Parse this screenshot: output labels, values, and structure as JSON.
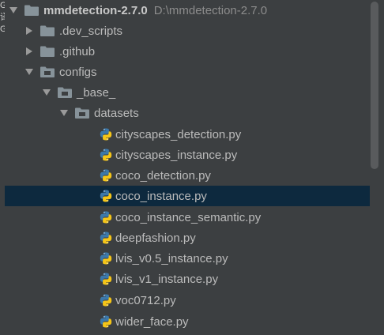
{
  "left_strip": [
    "G",
    "译",
    "G"
  ],
  "tree": {
    "root": {
      "label": "mmdetection-2.7.0",
      "path": "D:\\mmdetection-2.7.0"
    },
    "items": [
      {
        "label": ".dev_scripts"
      },
      {
        "label": ".github"
      },
      {
        "label": "configs"
      },
      {
        "label": "_base_"
      },
      {
        "label": "datasets"
      },
      {
        "label": "cityscapes_detection.py"
      },
      {
        "label": "cityscapes_instance.py"
      },
      {
        "label": "coco_detection.py"
      },
      {
        "label": "coco_instance.py"
      },
      {
        "label": "coco_instance_semantic.py"
      },
      {
        "label": "deepfashion.py"
      },
      {
        "label": "lvis_v0.5_instance.py"
      },
      {
        "label": "lvis_v1_instance.py"
      },
      {
        "label": "voc0712.py"
      },
      {
        "label": "wider_face.py"
      }
    ]
  },
  "colors": {
    "background": "#3c3f41",
    "selection": "#0d293e",
    "text": "#bbbbbb",
    "path_text": "#8c8c8c",
    "folder": "#87939a",
    "python_blue": "#3c78aa",
    "python_yellow": "#f5c518"
  }
}
